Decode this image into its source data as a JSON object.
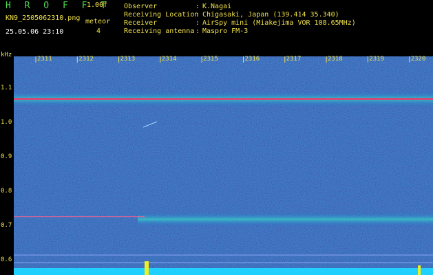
{
  "header": {
    "app_title": "H R O F F T",
    "version": "1.00f",
    "file_name": "KN9_2505062310.png",
    "meteor_label": "meteor",
    "meteor_count": "4",
    "datetime": "25.05.06 23:10",
    "info": [
      {
        "key": "Observer",
        "value": "K.Nagai"
      },
      {
        "key": "Receiving Location",
        "value": "Chigasaki, Japan (139.414 35.340)"
      },
      {
        "key": "Receiver",
        "value": "AirSpy mini (Miakejima VOR 108.65MHz)"
      },
      {
        "key": "Receiving antenna",
        "value": "Maspro FM-3"
      }
    ]
  },
  "spectrogram": {
    "y_unit": "kHz",
    "y_ticks": [
      "1.1",
      "1.0",
      "0.9",
      "0.8",
      "0.7",
      "0.6"
    ],
    "x_ticks": [
      "2311",
      "2312",
      "2313",
      "2314",
      "2315",
      "2316",
      "2317",
      "2318",
      "2319",
      "2320"
    ],
    "colors": {
      "label": "#f0e14a",
      "background": "#0c1a78",
      "trace": "#ff3060",
      "baseline": "#20d0ff"
    }
  }
}
